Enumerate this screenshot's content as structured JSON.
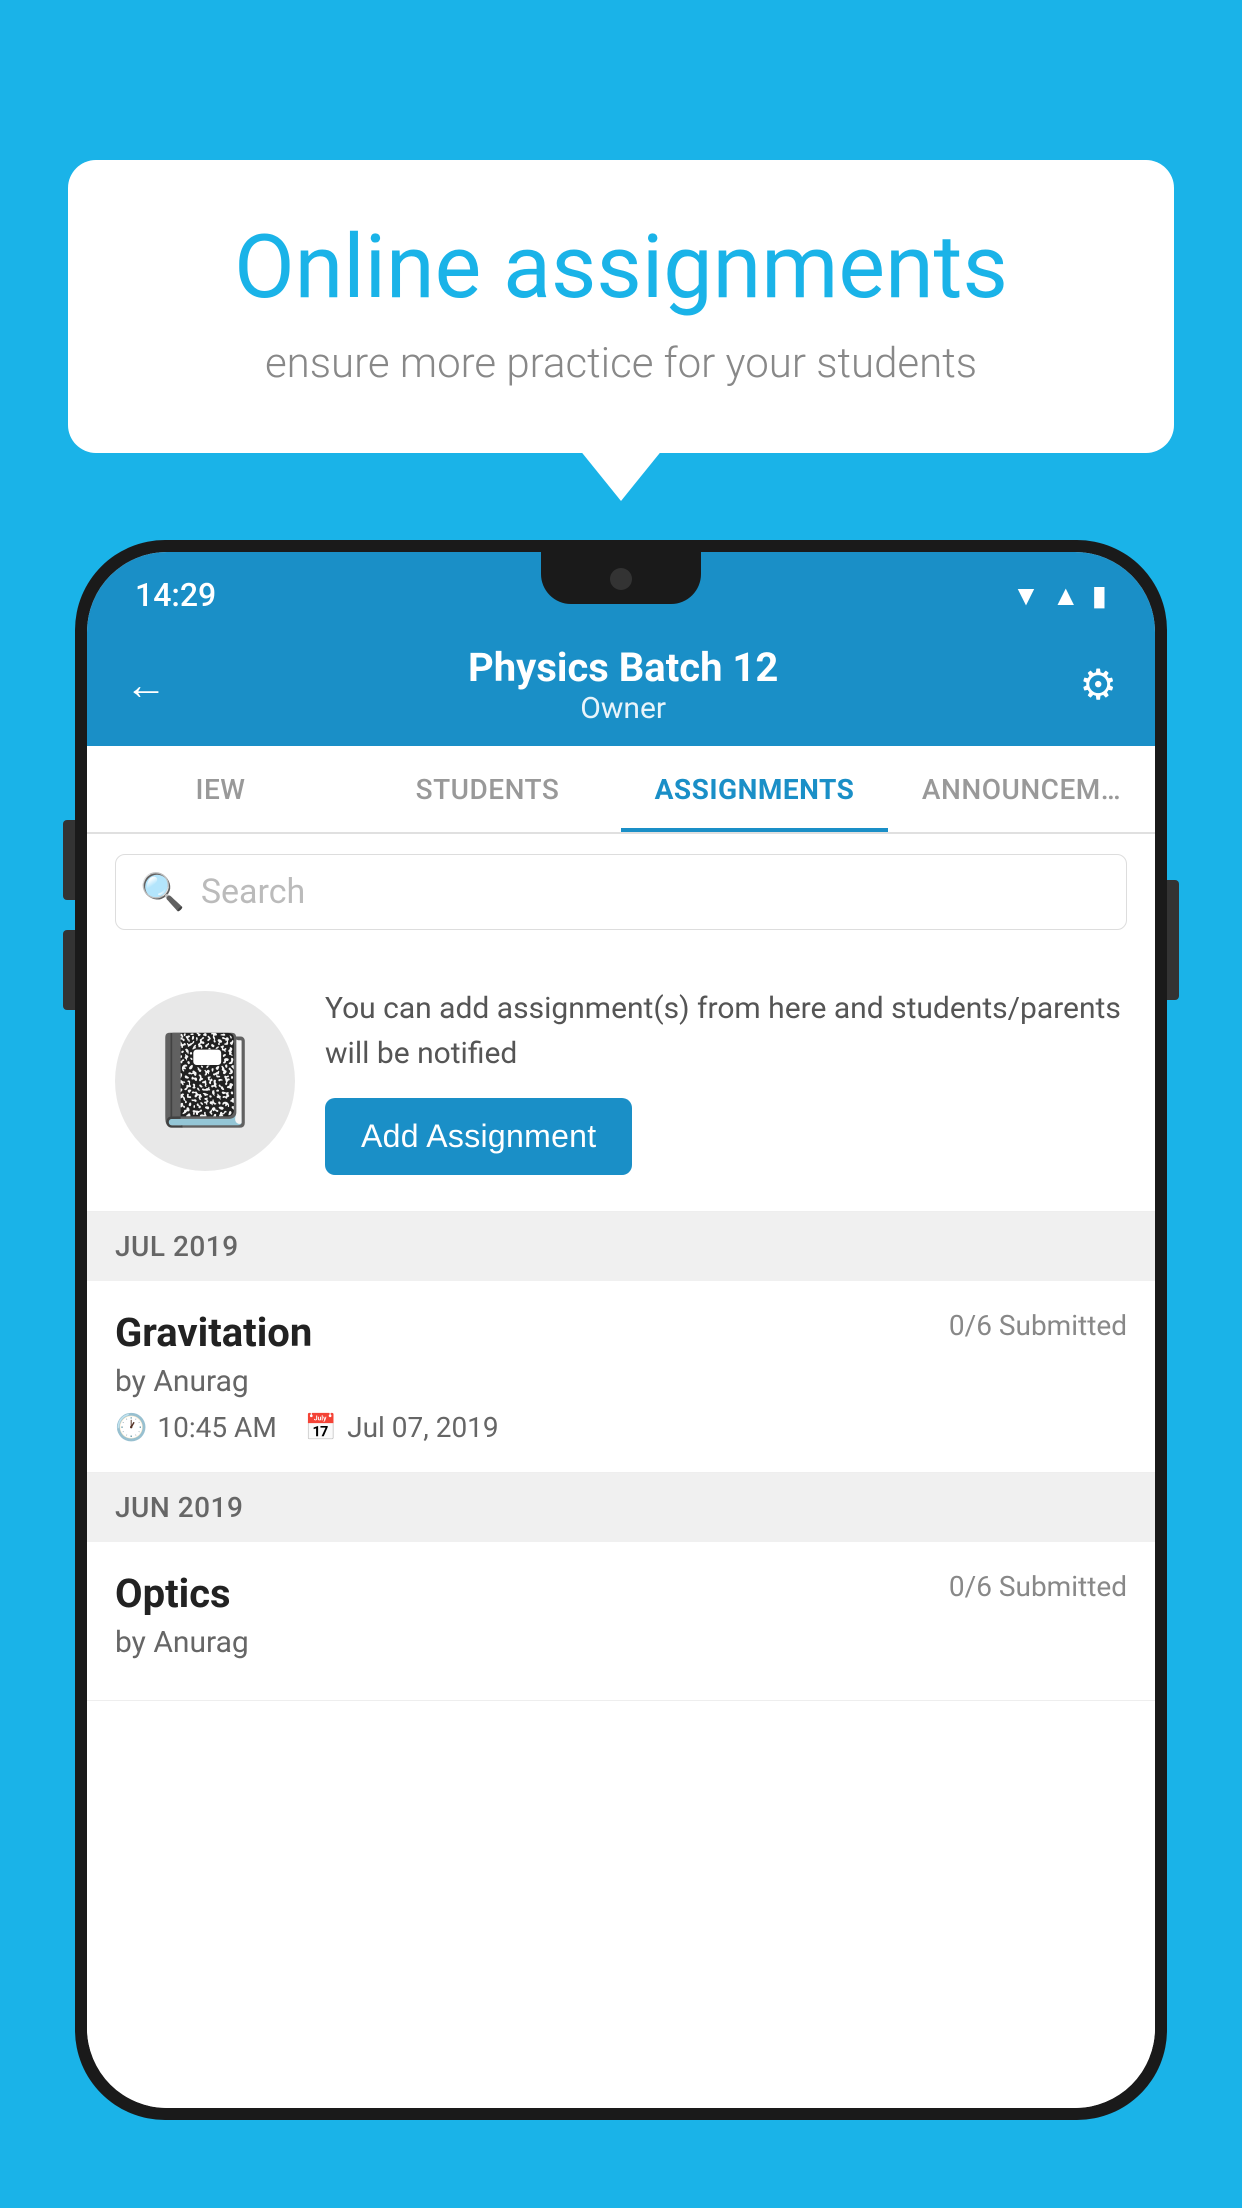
{
  "background": {
    "color": "#1ab3e8"
  },
  "speech_bubble": {
    "title": "Online assignments",
    "subtitle": "ensure more practice for your students"
  },
  "phone": {
    "status_bar": {
      "time": "14:29"
    },
    "header": {
      "title": "Physics Batch 12",
      "subtitle": "Owner",
      "back_label": "←",
      "settings_label": "⚙"
    },
    "tabs": [
      {
        "label": "IEW",
        "active": false
      },
      {
        "label": "STUDENTS",
        "active": false
      },
      {
        "label": "ASSIGNMENTS",
        "active": true
      },
      {
        "label": "ANNOUNCEM…",
        "active": false
      }
    ],
    "search": {
      "placeholder": "Search"
    },
    "promo": {
      "description": "You can add assignment(s) from here and students/parents will be notified",
      "button_label": "Add Assignment"
    },
    "sections": [
      {
        "month_label": "JUL 2019",
        "assignments": [
          {
            "title": "Gravitation",
            "submitted": "0/6 Submitted",
            "by": "by Anurag",
            "time": "10:45 AM",
            "date": "Jul 07, 2019"
          }
        ]
      },
      {
        "month_label": "JUN 2019",
        "assignments": [
          {
            "title": "Optics",
            "submitted": "0/6 Submitted",
            "by": "by Anurag",
            "time": "",
            "date": ""
          }
        ]
      }
    ]
  }
}
